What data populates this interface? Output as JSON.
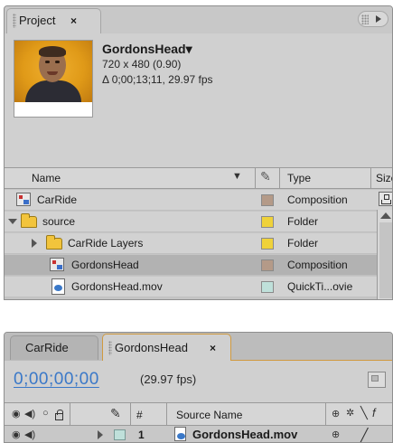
{
  "project_panel": {
    "tab_label": "Project",
    "tab_close": "×",
    "info": {
      "name": "GordonsHead▾",
      "dimensions": "720 x 480 (0.90)",
      "duration": "Δ 0;00;13;11, 29.97 fps"
    },
    "columns": {
      "name": "Name",
      "type": "Type",
      "size": "Size"
    },
    "items": [
      {
        "name": "CarRide",
        "type": "Composition",
        "label_color": "#b49a88"
      },
      {
        "name": "source",
        "type": "Folder",
        "label_color": "#efd23a"
      },
      {
        "name": "CarRide Layers",
        "type": "Folder",
        "label_color": "#efd23a"
      },
      {
        "name": "GordonsHead",
        "type": "Composition",
        "label_color": "#b49a88"
      },
      {
        "name": "GordonsHead.mov",
        "type": "QuickTi...ovie",
        "label_color": "#bfe0da"
      }
    ]
  },
  "timeline_panel": {
    "tabs": [
      {
        "label": "CarRide"
      },
      {
        "label": "GordonsHead",
        "close": "×"
      }
    ],
    "timecode": "0;00;00;00",
    "fps": "(29.97 fps)",
    "columns": {
      "number": "#",
      "source_name": "Source Name"
    },
    "layer": {
      "number": "1",
      "name": "GordonsHead.mov",
      "label_color": "#bfe0da"
    }
  },
  "colors": {
    "panel_bg": "#d0d0d0",
    "selected_row": "#b2b2b2",
    "timecode_blue": "#3a78c8",
    "active_tab_outline": "#d09a40"
  }
}
